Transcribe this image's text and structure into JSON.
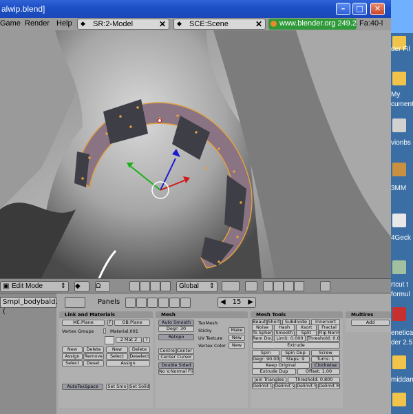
{
  "window": {
    "title": "alwip.blend]"
  },
  "menubar": {
    "items": [
      "Game",
      "Render",
      "Help"
    ],
    "screen": "SR:2-Model",
    "scene": "SCE:Scene",
    "url": "www.blender.org 249.2",
    "stats": "Fa:40-l"
  },
  "header": {
    "mode": "Edit Mode",
    "orientation": "Global"
  },
  "buttons": {
    "object_tab": "Smpl_bodybald.(",
    "panels_label": "Panels",
    "frame": "15",
    "link_materials": {
      "title": "Link and Materials",
      "me": "ME:Plane",
      "f": "F",
      "ob": "OB:Plane",
      "vertex_groups": "Vertex Groups",
      "material": "Material.001",
      "mat_count": "2 Mat 2",
      "q": "?",
      "new": "New",
      "delete": "Delete",
      "assign": "Assign",
      "remove": "Remove",
      "select": "Select",
      "deselect": "Desel.",
      "new2": "New",
      "delete2": "Delete",
      "select2": "Select",
      "deselect2": "Deselect",
      "assign2": "Assign",
      "autotex": "AutoTexSpace",
      "set_smooth": "Set Smo",
      "set_solid": "Set Solid"
    },
    "mesh": {
      "title": "Mesh",
      "auto_smooth": "Auto Smooth",
      "degr": "Degr: 30",
      "retopo": "Retopo",
      "texmesh": "TexMesh:",
      "sticky": "Sticky",
      "make": "Make",
      "uv_texture": "UV Texture",
      "new": "New",
      "vertex_color": "Vertex Color",
      "new2": "New",
      "centre": "Centre",
      "center_new": "Center New",
      "center_cursor": "Center Cursor",
      "double_sided": "Double Sided",
      "no_vnormal": "No V.Normal Flip"
    },
    "mesh_tools": {
      "title": "Mesh Tools",
      "beauty": "Beauty",
      "short": "Short",
      "subdivide": "Subdivide",
      "innervert": "Innervert",
      "noise": "Noise",
      "hash": "Hash",
      "xsort": "Xsort",
      "fractal": "Fractal",
      "to_sphere": "To Sphere",
      "smooth": "Smooth",
      "split": "Split",
      "flip_normals": "Flip Norm",
      "rem_doubles": "Rem Doubles",
      "limit": "Limit: 0.000",
      "threshold": "Threshold: 0.01",
      "extrude": "Extrude",
      "spin": "Spin",
      "spin_dup": "Spin Dup",
      "screw": "Screw",
      "degr": "Degr: 90.00",
      "steps": "Steps: 9",
      "turns": "Turns: 1",
      "keep_original": "Keep Original",
      "clockwise": "Clockwise",
      "extrude_dup": "Extrude Dup",
      "offset": "Offset: 1.00",
      "join_triangles": "Join Triangles",
      "threshold2": "Threshold: 0.800",
      "delimit_uv": "Delimit UV",
      "delimit_vcol": "Delimit Vcol",
      "delimit_sharp": "Delimit Sharp",
      "delimit_mat": "Delimit Mat"
    },
    "multires": {
      "title": "Multires",
      "add": "Add"
    }
  },
  "desktop": {
    "labels": [
      "der Fil",
      "My",
      "cument",
      "vionbs",
      "3MM",
      "4Geck",
      "rtcut t",
      "formul",
      "enetica",
      "der 2.5",
      "middan"
    ]
  }
}
